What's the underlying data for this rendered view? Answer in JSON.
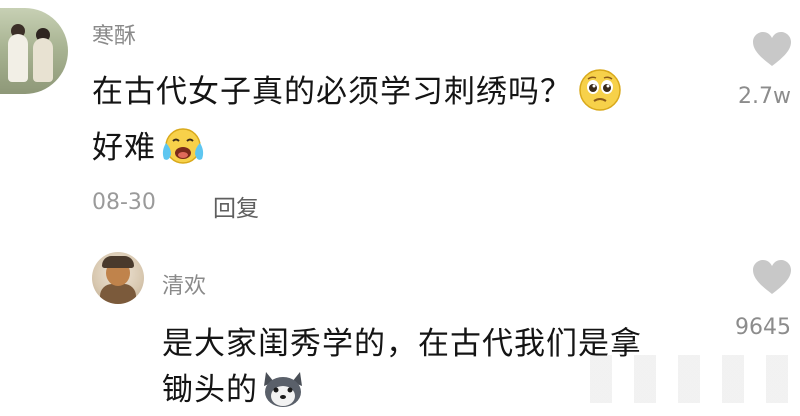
{
  "comment_main": {
    "username": "寒酥",
    "line1": "在古代女子真的必须学习刺绣吗？",
    "line2": "好难",
    "date": "08-30",
    "reply_label": "回复",
    "like_count": "2.7w"
  },
  "comment_reply": {
    "username": "清欢",
    "line1": "是大家闺秀学的，在古代我们是拿",
    "line2": "锄头的",
    "like_count": "9645"
  },
  "icons": {
    "like": "heart-icon",
    "emoji_pleading": "pleading-face-icon",
    "emoji_crying": "crying-face-icon",
    "emoji_husky": "husky-icon"
  },
  "colors": {
    "username": "#8a8a8a",
    "text": "#141414",
    "heart": "#c8c8c8",
    "emoji_yellow": "#f7d14a"
  }
}
